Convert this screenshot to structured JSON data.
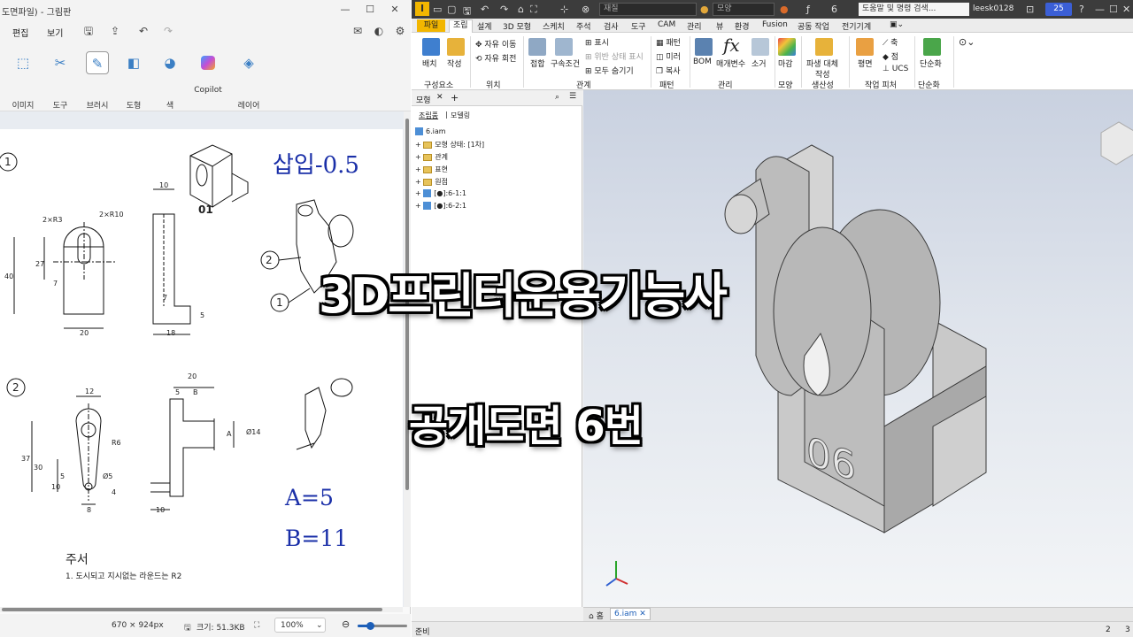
{
  "overlay": {
    "title_main": "3D프린터운용기능사",
    "title_sub": "공개도면 6번"
  },
  "paint": {
    "window_title": "도면파일) - 그림판",
    "menu": {
      "edit": "편집",
      "view": "보기"
    },
    "tools": [
      {
        "label": "이미지",
        "icon": "image-select-icon"
      },
      {
        "label": "도구",
        "icon": "tools-icon"
      },
      {
        "label": "브러시",
        "icon": "brush-icon"
      },
      {
        "label": "도형",
        "icon": "shapes-icon"
      },
      {
        "label": "색",
        "icon": "palette-icon"
      },
      {
        "label": "Copilot",
        "icon": "copilot-icon"
      },
      {
        "label": "레이어",
        "icon": "layers-icon"
      }
    ],
    "status": {
      "dimensions": "670 × 924px",
      "size": "크기: 51.3KB",
      "zoom": "100%",
      "zoom_fraction": 0.25
    },
    "drawing": {
      "insert_label": "삽입-0.5",
      "a_value": "A=5",
      "b_value": "B=11",
      "note_title": "주서",
      "note_1": "1. 도시되고 지시없는 라운드는 R2",
      "part_mark": "01",
      "callouts": [
        "1",
        "2",
        "1",
        "2"
      ],
      "dims_top_front": [
        "2×R3",
        "2×R10",
        "27",
        "7",
        "40",
        "20"
      ],
      "dims_top_side": [
        "10",
        "7",
        "5",
        "18"
      ],
      "dims_bottom_front": [
        "12",
        "R6",
        "37",
        "30",
        "10",
        "5",
        "Ø5",
        "4",
        "8"
      ],
      "dims_bottom_side": [
        "20",
        "5",
        "B",
        "A",
        "Ø14",
        "10"
      ]
    }
  },
  "inventor": {
    "quick_access": {
      "material": "재질",
      "appearance": "모양",
      "counter": "6",
      "search_placeholder": "도움말 및 명령 검색...",
      "user": "leesk0128",
      "clock": "25"
    },
    "tabs": [
      "파일",
      "조립",
      "설계",
      "3D 모형",
      "스케치",
      "주석",
      "검사",
      "도구",
      "CAM",
      "관리",
      "뷰",
      "환경",
      "Fusion",
      "공동 작업",
      "전기기계"
    ],
    "active_tab": "조립",
    "ribbon": {
      "place": "배치",
      "create": "작성",
      "free_move": "자유 이동",
      "free_rotate": "자유 회전",
      "join": "접합",
      "constrain": "구속조건",
      "show": "표시",
      "show_sick": "위반 상태 표시",
      "hide_all": "모두 숨기기",
      "pattern": "패턴",
      "mirror": "미러",
      "copy": "복사",
      "bom": "BOM",
      "params": "매개변수",
      "eliminate": "소거",
      "finish": "마감",
      "derive_replace": "파생 대체",
      "derive_replace_2": "작성",
      "plane": "평면",
      "axis": "축",
      "point": "점",
      "ucs": "UCS",
      "simplify": "단순화",
      "fx": "fx",
      "groups": [
        "구성요소",
        "위치",
        "관계",
        "패턴",
        "관리",
        "모양",
        "생산성",
        "작업 피처",
        "단순화"
      ]
    },
    "browser": {
      "header": "모형",
      "tab_assembly": "조립품",
      "tab_modeling": "모델링",
      "root": "6.iam",
      "items": [
        "모형 상태: [1차]",
        "관계",
        "표현",
        "원점",
        "[●]:6-1:1",
        "[●]:6-2:1"
      ]
    },
    "viewport": {
      "engraving": "06",
      "viewcube_label": "view-cube"
    },
    "doc_tabs": {
      "home": "홈",
      "active": "6.iam"
    },
    "status": {
      "left": "준비",
      "right_a": "2",
      "right_b": "3"
    }
  }
}
